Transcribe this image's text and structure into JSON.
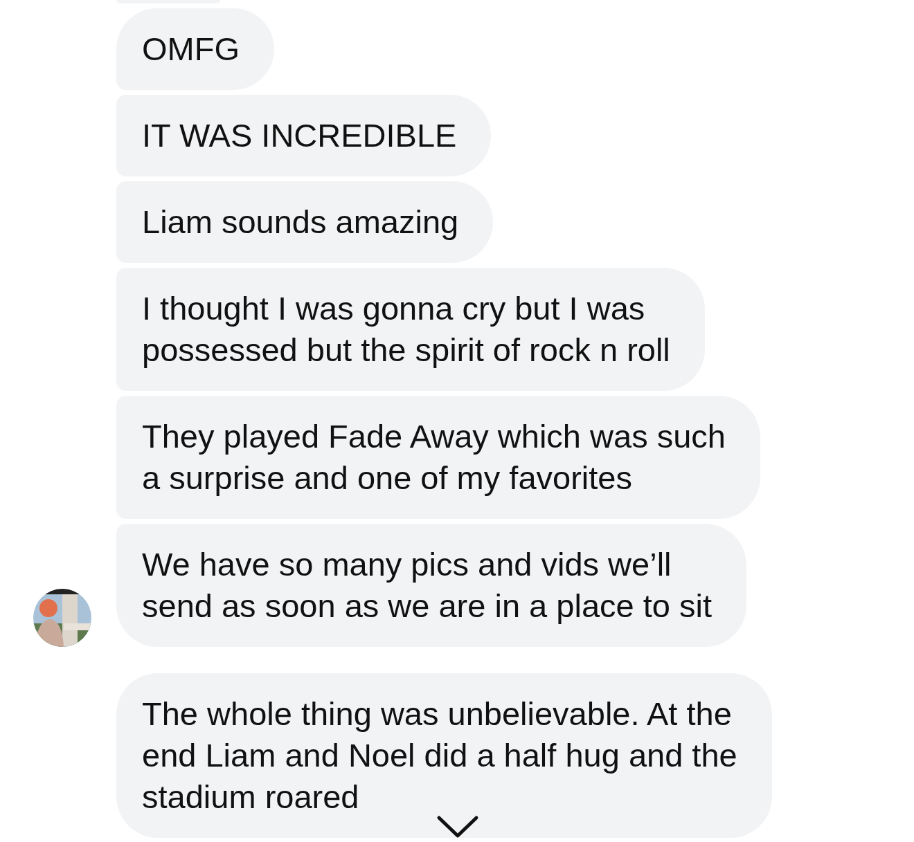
{
  "groups": [
    {
      "has_avatar": true,
      "messages": [
        {
          "text": "OMFG"
        },
        {
          "text": "IT WAS INCREDIBLE"
        },
        {
          "text": "Liam sounds amazing"
        },
        {
          "text": "I thought I was gonna cry but I was\npossessed but the spirit of rock n roll"
        },
        {
          "text": "They played Fade Away which was such\na surprise and one of my favorites"
        },
        {
          "text": "We have so many pics and vids we’ll\nsend as soon as we are in a place to sit"
        }
      ]
    },
    {
      "has_avatar": false,
      "messages": [
        {
          "text": "The whole thing was unbelievable. At the\nend Liam and Noel did a half hug and the\nstadium roared"
        }
      ]
    }
  ],
  "scroll_down_button": {
    "visible": true
  }
}
